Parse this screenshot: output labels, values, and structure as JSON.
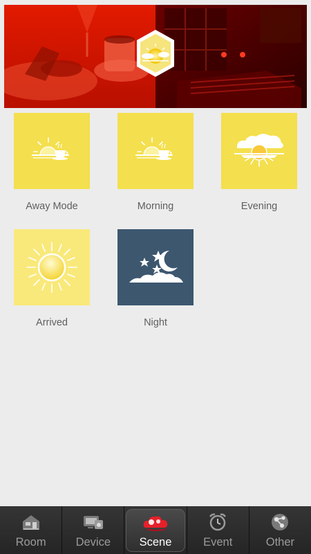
{
  "banner": {
    "badge_icon": "sun-hexagon-icon"
  },
  "scenes": [
    {
      "label": "Away Mode",
      "icon": "sunrise-coffee-icon",
      "color": "#f4df4e"
    },
    {
      "label": "Morning",
      "icon": "sunrise-coffee-icon",
      "color": "#f4df4e"
    },
    {
      "label": "Evening",
      "icon": "sunset-clouds-icon",
      "color": "#f4df4e"
    },
    {
      "label": "Arrived",
      "icon": "sun-icon",
      "color": "#f9e97a"
    },
    {
      "label": "Night",
      "icon": "moon-stars-icon",
      "color": "#3d576f"
    }
  ],
  "tabbar": {
    "active": "Scene",
    "tabs": [
      {
        "label": "Room",
        "icon": "house-icon"
      },
      {
        "label": "Device",
        "icon": "tv-device-icon"
      },
      {
        "label": "Scene",
        "icon": "scene-cloud-icon"
      },
      {
        "label": "Event",
        "icon": "alarm-clock-icon"
      },
      {
        "label": "Other",
        "icon": "share-nodes-icon"
      }
    ]
  }
}
